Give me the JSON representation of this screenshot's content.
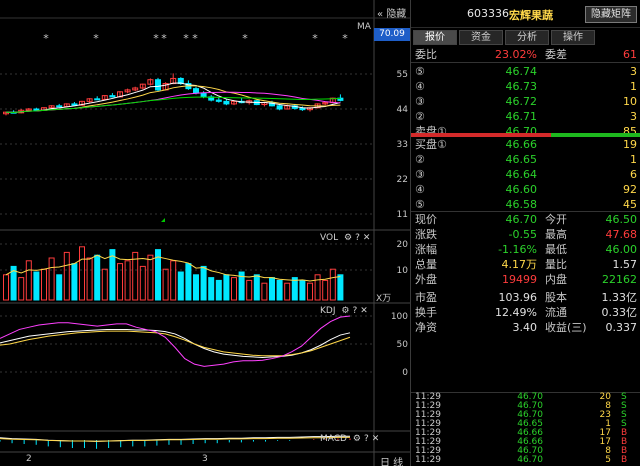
{
  "chart": {
    "hide_label": "隐藏",
    "current_price_box": "70.09",
    "ma_label": "MA",
    "price_axis": [
      "55",
      "44",
      "33",
      "22",
      "11"
    ],
    "vol_label": "VOL",
    "vol_axis": [
      "20",
      "10"
    ],
    "vol_unit": "X万",
    "kdj_label": "KDJ",
    "kdj_axis": [
      "100",
      "50",
      "0"
    ],
    "macd_label": "MACD",
    "x_labels": [
      "2",
      "3"
    ],
    "period_label": "日 线",
    "colors": {
      "up": "#ff3c3c",
      "down": "#00e8ff",
      "ma1": "#ffffff",
      "ma2": "#ffd84a",
      "ma3": "#ff40ff",
      "ma4": "#00dc00"
    }
  },
  "chart_data": {
    "type": "candlestick",
    "y_range": [
      11,
      66
    ],
    "candles": [
      [
        42.5,
        43.2,
        42.0,
        43.0
      ],
      [
        43.0,
        43.6,
        42.6,
        42.8
      ],
      [
        42.8,
        44.0,
        42.6,
        43.6
      ],
      [
        43.6,
        44.3,
        43.2,
        44.0
      ],
      [
        44.0,
        44.4,
        43.4,
        43.6
      ],
      [
        43.6,
        44.6,
        43.4,
        44.4
      ],
      [
        44.4,
        45.2,
        44.0,
        45.0
      ],
      [
        45.0,
        45.6,
        44.6,
        44.8
      ],
      [
        44.8,
        45.8,
        44.6,
        45.6
      ],
      [
        45.6,
        46.2,
        45.0,
        45.2
      ],
      [
        45.2,
        46.6,
        45.0,
        46.4
      ],
      [
        46.4,
        47.4,
        46.0,
        47.2
      ],
      [
        47.2,
        48.0,
        46.8,
        47.0
      ],
      [
        47.0,
        48.4,
        46.8,
        48.2
      ],
      [
        48.2,
        49.0,
        47.6,
        47.8
      ],
      [
        47.8,
        49.6,
        47.6,
        49.4
      ],
      [
        49.4,
        50.4,
        49.0,
        50.0
      ],
      [
        50.0,
        51.0,
        49.6,
        50.6
      ],
      [
        50.6,
        52.0,
        50.2,
        51.8
      ],
      [
        51.8,
        53.6,
        51.4,
        53.2
      ],
      [
        53.2,
        53.8,
        49.6,
        50.0
      ],
      [
        50.0,
        52.4,
        49.8,
        52.0
      ],
      [
        52.0,
        55.2,
        51.8,
        53.6
      ],
      [
        53.6,
        54.0,
        51.6,
        52.0
      ],
      [
        52.0,
        53.0,
        50.0,
        50.4
      ],
      [
        50.4,
        51.0,
        48.6,
        49.0
      ],
      [
        49.0,
        49.6,
        47.4,
        47.8
      ],
      [
        47.8,
        48.4,
        46.4,
        46.8
      ],
      [
        46.8,
        47.6,
        46.0,
        46.4
      ],
      [
        46.4,
        47.2,
        45.2,
        45.6
      ],
      [
        45.6,
        46.8,
        45.2,
        46.4
      ],
      [
        46.4,
        47.4,
        45.8,
        46.0
      ],
      [
        46.0,
        47.0,
        45.4,
        46.6
      ],
      [
        46.6,
        46.8,
        45.2,
        45.4
      ],
      [
        45.4,
        46.2,
        44.8,
        46.0
      ],
      [
        46.0,
        46.6,
        44.8,
        45.0
      ],
      [
        45.0,
        45.4,
        43.6,
        44.0
      ],
      [
        44.0,
        45.4,
        43.8,
        45.0
      ],
      [
        45.0,
        45.6,
        43.8,
        44.2
      ],
      [
        44.2,
        44.8,
        43.4,
        43.8
      ],
      [
        43.8,
        44.6,
        43.2,
        44.4
      ],
      [
        44.4,
        45.8,
        44.2,
        45.6
      ],
      [
        45.6,
        46.4,
        45.2,
        46.0
      ],
      [
        46.0,
        47.6,
        45.8,
        47.4
      ],
      [
        47.4,
        48.6,
        46.4,
        46.7
      ]
    ],
    "volume": [
      9,
      12,
      8,
      14,
      10,
      11,
      15,
      9,
      17,
      13,
      19,
      15,
      16,
      11,
      18,
      13,
      14,
      17,
      12,
      16,
      18,
      11,
      14,
      10,
      13,
      9,
      12,
      8,
      7,
      9,
      8,
      10,
      7,
      9,
      6,
      8,
      7,
      6,
      8,
      7,
      6,
      9,
      7,
      11,
      9
    ],
    "kdj": {
      "k": [
        52,
        56,
        60,
        64,
        66,
        68,
        70,
        72,
        73,
        74,
        75,
        76,
        76,
        76,
        75,
        75,
        74,
        72,
        68,
        60,
        50,
        42,
        36,
        32,
        30,
        28,
        27,
        26,
        27,
        28,
        30,
        34,
        40,
        48,
        58,
        66,
        70
      ],
      "d": [
        48,
        50,
        54,
        58,
        61,
        64,
        66,
        68,
        70,
        71,
        72,
        73,
        73,
        73,
        72,
        71,
        70,
        68,
        63,
        57,
        50,
        44,
        40,
        36,
        34,
        32,
        30,
        29,
        29,
        29,
        31,
        34,
        38,
        44,
        50,
        56,
        62
      ],
      "j": [
        60,
        68,
        76,
        80,
        84,
        86,
        88,
        88,
        86,
        84,
        82,
        84,
        86,
        86,
        80,
        76,
        72,
        62,
        44,
        24,
        14,
        10,
        12,
        14,
        18,
        20,
        20,
        21,
        24,
        28,
        36,
        46,
        62,
        78,
        90,
        98,
        100
      ]
    },
    "macd": [
      -0.2,
      -0.4,
      -0.5,
      -0.6,
      -0.8,
      -0.9,
      -1.0,
      -1.0,
      -1.1,
      -1.0,
      -0.9,
      -0.8,
      -0.8,
      -0.7,
      -0.6,
      -0.6,
      -0.5,
      -0.4,
      -0.4,
      -0.3,
      -0.3,
      -0.2,
      -0.2,
      -0.1,
      -0.1,
      0.0,
      0.1,
      0.1,
      0.2,
      0.2
    ]
  },
  "panel": {
    "code": "603336",
    "name": "宏辉果蔬",
    "hide_button": "隐藏矩阵",
    "tabs": [
      "报价",
      "资金",
      "分析",
      "操作"
    ],
    "webi_label": "委比",
    "webi_value": "23.02%",
    "weicha_label": "委差",
    "weicha_value": "61",
    "sell": [
      {
        "label": "⑤",
        "price": "46.74",
        "vol": "3"
      },
      {
        "label": "④",
        "price": "46.73",
        "vol": "1"
      },
      {
        "label": "③",
        "price": "46.72",
        "vol": "10"
      },
      {
        "label": "②",
        "price": "46.71",
        "vol": "3"
      },
      {
        "label": "卖盘①",
        "price": "46.70",
        "vol": "85"
      }
    ],
    "buy": [
      {
        "label": "买盘①",
        "price": "46.66",
        "vol": "19"
      },
      {
        "label": "②",
        "price": "46.65",
        "vol": "1"
      },
      {
        "label": "③",
        "price": "46.64",
        "vol": "6"
      },
      {
        "label": "④",
        "price": "46.60",
        "vol": "92"
      },
      {
        "label": "⑤",
        "price": "46.58",
        "vol": "45"
      }
    ],
    "stats": [
      {
        "l1": "现价",
        "v1": "46.70",
        "c1": "green",
        "l2": "今开",
        "v2": "46.50",
        "c2": "green"
      },
      {
        "l1": "涨跌",
        "v1": "-0.55",
        "c1": "green",
        "l2": "最高",
        "v2": "47.68",
        "c2": "red"
      },
      {
        "l1": "涨幅",
        "v1": "-1.16%",
        "c1": "green",
        "l2": "最低",
        "v2": "46.00",
        "c2": "green"
      },
      {
        "l1": "总量",
        "v1": "4.17万",
        "c1": "yellow",
        "l2": "量比",
        "v2": "1.57",
        "c2": "white"
      },
      {
        "l1": "外盘",
        "v1": "19499",
        "c1": "red",
        "l2": "内盘",
        "v2": "22162",
        "c2": "green"
      },
      {
        "l1": "市盈",
        "v1": "103.96",
        "c1": "white",
        "l2": "股本",
        "v2": "1.33亿",
        "c2": "white"
      },
      {
        "l1": "换手",
        "v1": "12.49%",
        "c1": "white",
        "l2": "流通",
        "v2": "0.33亿",
        "c2": "white"
      },
      {
        "l1": "净资",
        "v1": "3.40",
        "c1": "white",
        "l2": "收益(三)",
        "v2": "0.337",
        "c2": "white"
      }
    ],
    "ticks": [
      {
        "time": "11:29",
        "price": "46.70",
        "vol": "20",
        "side": "S",
        "sc": "green"
      },
      {
        "time": "11:29",
        "price": "46.70",
        "vol": "8",
        "side": "S",
        "sc": "green"
      },
      {
        "time": "11:29",
        "price": "46.70",
        "vol": "23",
        "side": "S",
        "sc": "green"
      },
      {
        "time": "11:29",
        "price": "46.65",
        "vol": "1",
        "side": "S",
        "sc": "green"
      },
      {
        "time": "11:29",
        "price": "46.66",
        "vol": "17",
        "side": "B",
        "sc": "red"
      },
      {
        "time": "11:29",
        "price": "46.66",
        "vol": "17",
        "side": "B",
        "sc": "red"
      },
      {
        "time": "11:29",
        "price": "46.70",
        "vol": "8",
        "side": "B",
        "sc": "red"
      },
      {
        "time": "11:29",
        "price": "46.70",
        "vol": "5",
        "side": "B",
        "sc": "red"
      }
    ]
  }
}
